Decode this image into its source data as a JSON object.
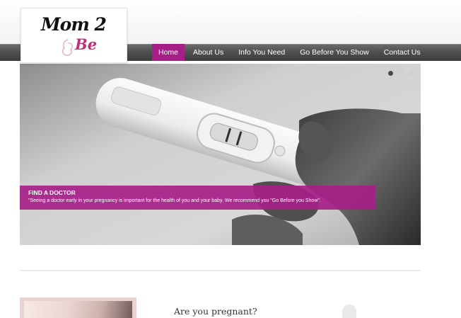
{
  "logo": {
    "line1": "Mom 2",
    "line2": "Be"
  },
  "nav": {
    "items": [
      {
        "label": "Home",
        "active": true
      },
      {
        "label": "About Us",
        "active": false
      },
      {
        "label": "Info You Need",
        "active": false
      },
      {
        "label": "Go Before You Show",
        "active": false
      },
      {
        "label": "Contact Us",
        "active": false
      }
    ]
  },
  "slider": {
    "dots": 3,
    "active_dot": 1,
    "caption": {
      "title": "FIND A DOCTOR",
      "text": "\"Seeing a doctor early in your pregnancy is important for the health of you and your baby. We recommend you \"Go Before you Show\"."
    }
  },
  "section": {
    "title": "Are you pregnant?"
  },
  "colors": {
    "accent": "#a61f87",
    "nav_bg": "#4e4e4e",
    "logo_pink": "#c0307e"
  }
}
